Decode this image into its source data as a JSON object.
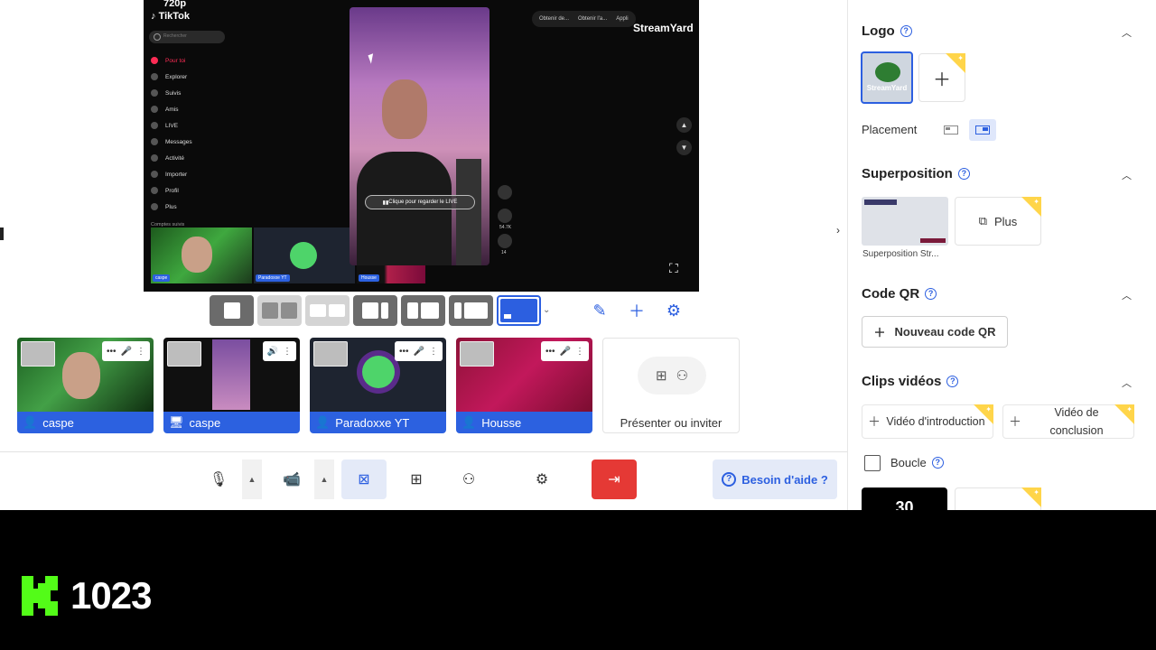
{
  "stage": {
    "resolution_badge": "720p",
    "tiktok": {
      "brand": "TikTok",
      "search_placeholder": "Rechercher",
      "nav": [
        "Pour toi",
        "Explorer",
        "Suivis",
        "Amis",
        "LIVE",
        "Messages",
        "Activité",
        "Importer",
        "Profil",
        "Plus"
      ],
      "followed_label": "Comptes suivis",
      "live_pill": "Clique pour regarder le LIVE",
      "top_pills": [
        "Obtenir de...",
        "Obtenir l'a...",
        "Appli"
      ],
      "stats": [
        "54.7K",
        "14"
      ],
      "mini_labels": [
        "caspe",
        "Paradoxxe YT",
        "Housse"
      ]
    },
    "watermark": "StreamYard"
  },
  "guests": [
    {
      "name": "caspe",
      "kind": "camera"
    },
    {
      "name": "caspe",
      "kind": "screen"
    },
    {
      "name": "Paradoxxe YT",
      "kind": "camera"
    },
    {
      "name": "Housse",
      "kind": "camera"
    }
  ],
  "invite": {
    "label": "Présenter ou inviter"
  },
  "help": {
    "label": "Besoin d'aide ?"
  },
  "side": {
    "logo": {
      "title": "Logo",
      "thumb_text": "StreamYard"
    },
    "placement": {
      "label": "Placement"
    },
    "overlay": {
      "title": "Superposition",
      "thumb_label": "Superposition Str...",
      "plus_label": "Plus"
    },
    "qr": {
      "title": "Code QR",
      "button": "Nouveau code QR"
    },
    "clips": {
      "title": "Clips vidéos",
      "intro": "Vidéo d'introduction",
      "outro": "Vidéo de conclusion",
      "loop": "Boucle",
      "thumb_text": "30"
    }
  },
  "kick": {
    "count": "1023"
  },
  "colors": {
    "accent": "#2c5fe0",
    "exit": "#e53935",
    "premium": "#ffd54a",
    "kick": "#53fc18"
  },
  "icons": {
    "mic": "mic-icon",
    "camera": "camera-icon",
    "screen": "screen-share-icon",
    "present": "present-icon",
    "invite": "add-person-icon",
    "settings": "gear-icon",
    "exit": "exit-icon",
    "edit": "pencil-icon",
    "add": "plus-icon"
  }
}
